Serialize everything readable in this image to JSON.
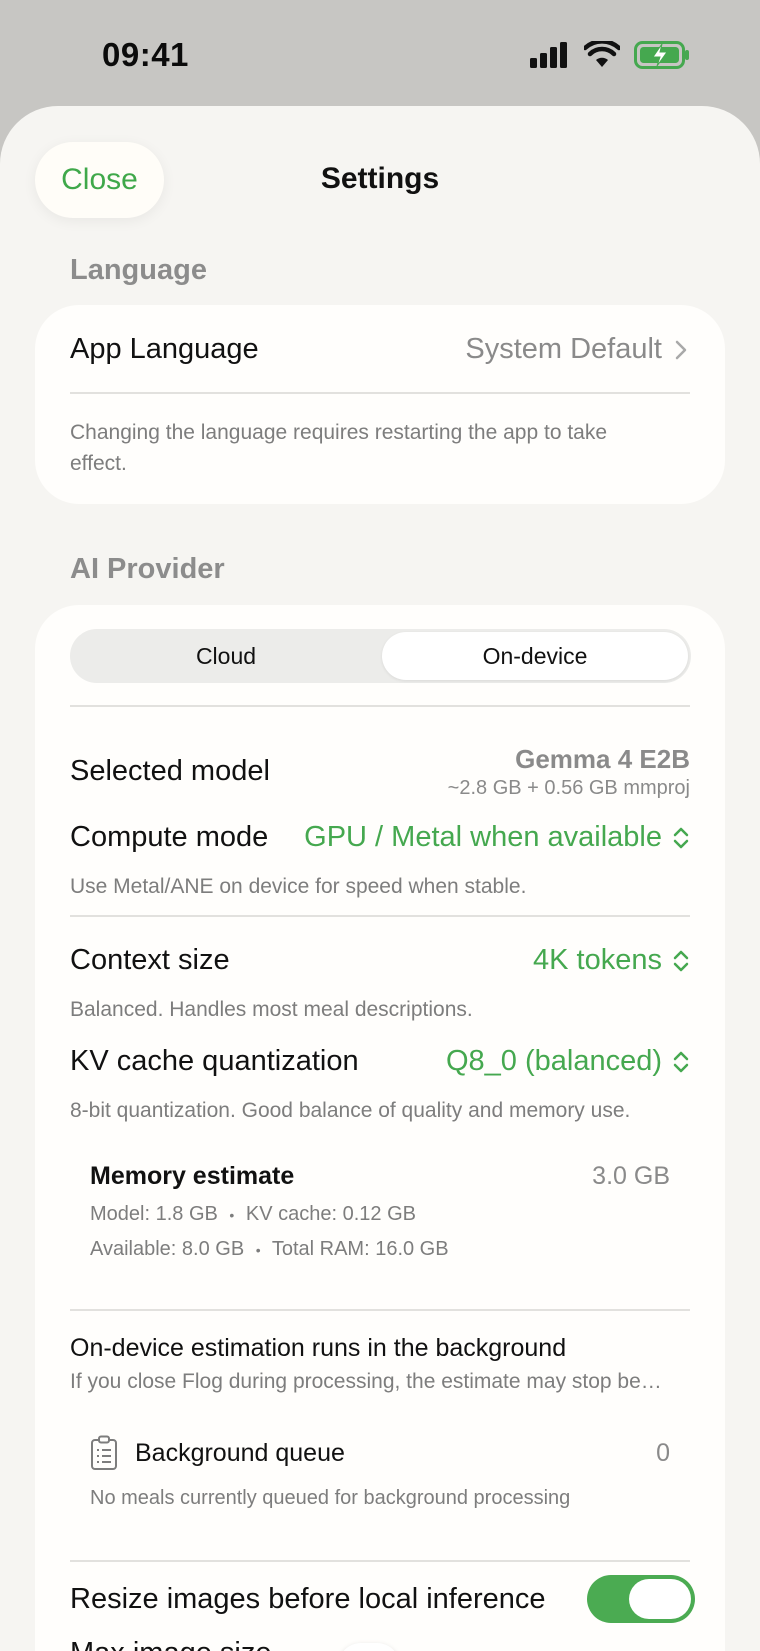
{
  "status": {
    "time": "09:41"
  },
  "header": {
    "close_label": "Close",
    "title": "Settings"
  },
  "language": {
    "section_title": "Language",
    "app_language_label": "App Language",
    "app_language_value": "System Default",
    "note": "Changing the language requires restarting the app to take effect."
  },
  "ai_provider": {
    "section_title": "AI Provider",
    "segments": [
      "Cloud",
      "On-device"
    ],
    "selected_segment": "On-device",
    "selected_model_label": "Selected model",
    "selected_model_name": "Gemma 4 E2B",
    "selected_model_size": "~2.8 GB + 0.56 GB mmproj",
    "compute_mode_label": "Compute mode",
    "compute_mode_value": "GPU / Metal when available",
    "compute_mode_desc": "Use Metal/ANE on device for speed when stable.",
    "context_size_label": "Context size",
    "context_size_value": "4K tokens",
    "context_size_desc": "Balanced. Handles most meal descriptions.",
    "kv_label": "KV cache quantization",
    "kv_value": "Q8_0 (balanced)",
    "kv_desc": "8-bit quantization. Good balance of quality and memory use.",
    "memory": {
      "title": "Memory estimate",
      "total": "3.0 GB",
      "model": "Model: 1.8 GB",
      "kv_cache": "KV cache: 0.12 GB",
      "available": "Available: 8.0 GB",
      "total_ram": "Total RAM: 16.0 GB",
      "separator": "•"
    },
    "background_title": "On-device estimation runs in the background",
    "background_desc": "If you close Flog during processing, the estimate may stop be…",
    "queue_label": "Background queue",
    "queue_count": "0",
    "queue_desc": "No meals currently queued for background processing",
    "resize_label": "Resize images before local inference",
    "resize_enabled": true,
    "max_image_label": "Max image size",
    "max_image_slider_fraction": 0.13
  },
  "colors": {
    "accent": "#45a84f",
    "sheet_bg": "#f6f5f2",
    "card_bg": "#fffefc"
  }
}
